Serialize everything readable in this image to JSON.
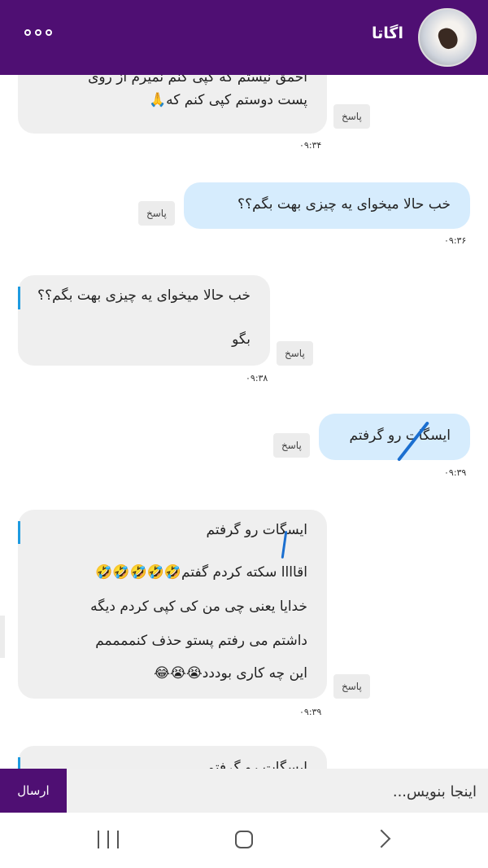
{
  "header": {
    "contact_name": "اگاتا",
    "menu_icon": "more-dots-icon",
    "avatar_icon": "contact-avatar"
  },
  "messages": [
    {
      "direction": "incoming",
      "lines": [
        "احمق نیستم که کپی کنم نمیرم از روی",
        "پست دوستم کپی کنم که🙏"
      ],
      "reply_label": "پاسخ",
      "time": "۰۹:۳۴"
    },
    {
      "direction": "outgoing",
      "lines": [
        "خب حالا میخوای یه چیزی بهت بگم؟؟"
      ],
      "reply_label": "پاسخ",
      "time": "۰۹:۳۶"
    },
    {
      "direction": "incoming",
      "quote": "خب حالا میخوای یه چیزی بهت بگم؟؟",
      "lines": [
        "بگو"
      ],
      "reply_label": "پاسخ",
      "time": "۰۹:۳۸"
    },
    {
      "direction": "outgoing",
      "lines": [
        "ایسگات رو گرفتم"
      ],
      "reply_label": "پاسخ",
      "time": "۰۹:۳۹"
    },
    {
      "direction": "incoming",
      "quote": "ایسگات رو گرفتم",
      "lines": [
        "اقاااا سکته کردم گفتم🤣🤣🤣🤣🤣",
        "خدایا یعنی چی من کی کپی کردم دیگه",
        "داشتم می رفتم پستو حذف کنممممم",
        "این چه کاری بوددد😭😭😂"
      ],
      "reply_label": "پاسخ",
      "time": "۰۹:۳۹"
    },
    {
      "direction": "incoming",
      "quote": "ایسگات رو گرفتم"
    }
  ],
  "composer": {
    "placeholder": "اینجا بنویس...",
    "send_label": "ارسال"
  },
  "navbar": {
    "recents_icon": "recents-icon",
    "home_icon": "home-icon",
    "back_icon": "back-icon"
  },
  "colors": {
    "header": "#4f0f73",
    "incoming_bubble": "#efefef",
    "outgoing_bubble": "#d6ecfd",
    "quote_bar": "#1e9be0",
    "pen_stroke": "#1b6fd0"
  }
}
